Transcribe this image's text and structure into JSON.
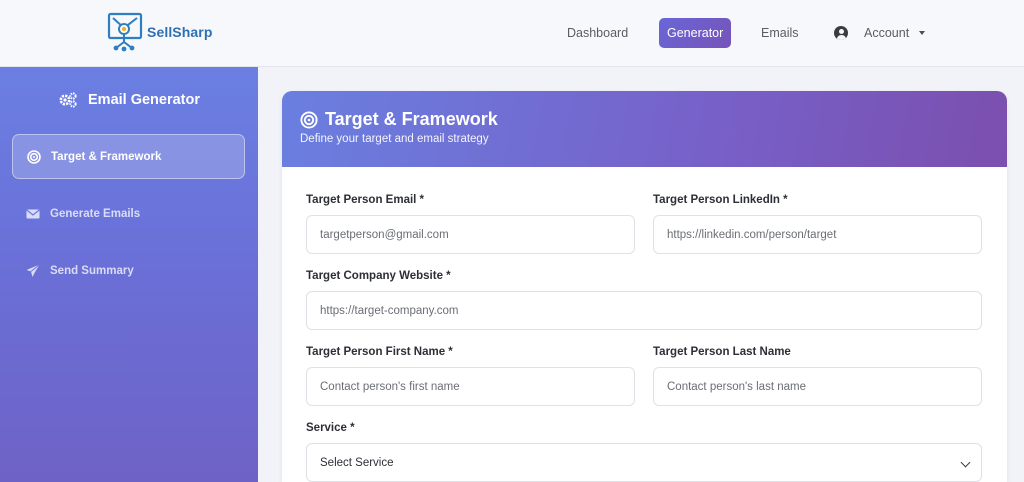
{
  "brand": {
    "name": "SellSharp",
    "logo_icon": "presentation-board-icon",
    "color": "#2f6fb3"
  },
  "nav": {
    "dashboard": "Dashboard",
    "generator": "Generator",
    "emails": "Emails",
    "account": "Account"
  },
  "sidebar": {
    "title": "Email Generator",
    "items": [
      {
        "label": "Target & Framework",
        "icon": "target-icon",
        "active": true
      },
      {
        "label": "Generate Emails",
        "icon": "envelope-icon",
        "active": false
      },
      {
        "label": "Send Summary",
        "icon": "paper-plane-icon",
        "active": false
      }
    ]
  },
  "card": {
    "title": "Target & Framework",
    "subtitle": "Define your target and email strategy"
  },
  "form": {
    "target_email": {
      "label": "Target Person Email *",
      "placeholder": "targetperson@gmail.com"
    },
    "target_linkedin": {
      "label": "Target Person LinkedIn *",
      "placeholder": "https://linkedin.com/person/target"
    },
    "company_website": {
      "label": "Target Company Website *",
      "placeholder": "https://target-company.com"
    },
    "first_name": {
      "label": "Target Person First Name *",
      "placeholder": "Contact person's first name"
    },
    "last_name": {
      "label": "Target Person Last Name",
      "placeholder": "Contact person's last name"
    },
    "service": {
      "label": "Service *",
      "value": "Select Service"
    }
  },
  "colors": {
    "accent": "#6f63c9",
    "sidebar_top": "#6b7fe3",
    "sidebar_bottom": "#6f62c6"
  }
}
